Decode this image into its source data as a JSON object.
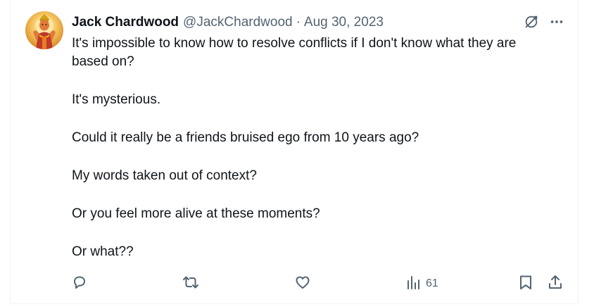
{
  "tweet": {
    "author_name": "Jack Chardwood",
    "handle": "@JackChardwood",
    "separator": "·",
    "date": "Aug 30, 2023",
    "paragraphs": [
      "It's impossible to know how to resolve conflicts if I don't know what they are based on?",
      "It's mysterious.",
      "Could it really be a friends bruised ego from 10 years ago?",
      "My words taken out of context?",
      "Or you feel more alive at these moments?",
      "Or what??"
    ],
    "views_count": "61"
  },
  "icons": {
    "grok": "grok-icon",
    "more": "more-icon",
    "reply": "reply-icon",
    "retweet": "retweet-icon",
    "like": "like-icon",
    "views": "views-icon",
    "bookmark": "bookmark-icon",
    "share": "share-icon"
  },
  "colors": {
    "text": "#0f1419",
    "secondary": "#536471",
    "border": "#eff3f4"
  }
}
